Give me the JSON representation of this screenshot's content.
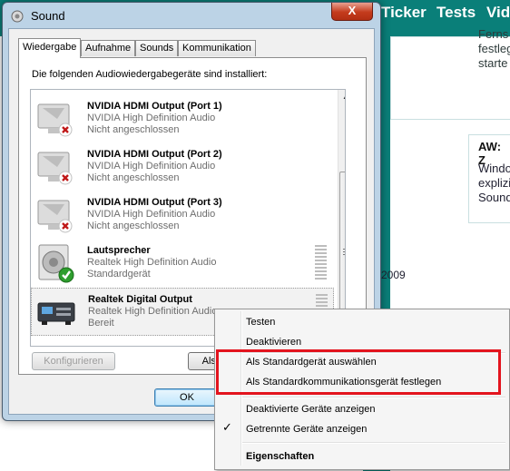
{
  "background_page": {
    "nav": [
      "Ticker",
      "Tests",
      "Vide"
    ],
    "snippet_top": "Ferns\nfestlege\nstarte",
    "post_title": "AW: Z",
    "post_text": "Windo\nexplizi\nSound",
    "year_text": "2009"
  },
  "window": {
    "title": "Sound",
    "close_label": "X"
  },
  "tabs": [
    {
      "label": "Wiedergabe",
      "active": true
    },
    {
      "label": "Aufnahme",
      "active": false
    },
    {
      "label": "Sounds",
      "active": false
    },
    {
      "label": "Kommunikation",
      "active": false
    }
  ],
  "intro": "Die folgenden Audiowiedergabegeräte sind installiert:",
  "devices": [
    {
      "name": "NVIDIA HDMI Output (Port 1)",
      "driver": "NVIDIA High Definition Audio",
      "status": "Nicht angeschlossen",
      "icon": "monitor-disconnected-icon"
    },
    {
      "name": "NVIDIA HDMI Output (Port 2)",
      "driver": "NVIDIA High Definition Audio",
      "status": "Nicht angeschlossen",
      "icon": "monitor-disconnected-icon"
    },
    {
      "name": "NVIDIA HDMI Output (Port 3)",
      "driver": "NVIDIA High Definition Audio",
      "status": "Nicht angeschlossen",
      "icon": "monitor-disconnected-icon"
    },
    {
      "name": "Lautsprecher",
      "driver": "Realtek High Definition Audio",
      "status": "Standardgerät",
      "icon": "speaker-default-icon"
    },
    {
      "name": "Realtek Digital Output",
      "driver": "Realtek High Definition Audio",
      "status": "Bereit",
      "icon": "digital-output-icon"
    }
  ],
  "buttons": {
    "configure": "Konfigurieren",
    "set_default": "Als St",
    "ok": "OK"
  },
  "context_menu": {
    "items": [
      "Testen",
      "Deaktivieren",
      "Als Standardgerät auswählen",
      "Als Standardkommunikationsgerät festlegen",
      "Deaktivierte Geräte anzeigen",
      "Getrennte Geräte anzeigen",
      "Eigenschaften"
    ],
    "checked_item": "Getrennte Geräte anzeigen",
    "check_mark": "✓"
  },
  "colors": {
    "highlight_box": "#e3141e",
    "site_teal": "#0a7f79"
  }
}
